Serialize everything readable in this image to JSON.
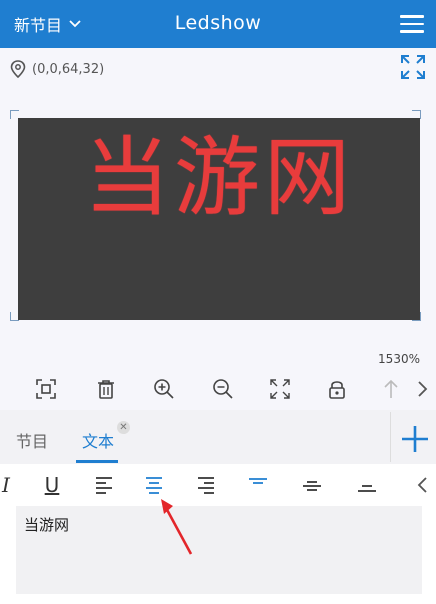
{
  "header": {
    "program_label": "新节目",
    "title": "Ledshow",
    "menu_icon": "menu-icon",
    "accent_color": "#1f7ed0"
  },
  "stage": {
    "coord_text": "(0,0,64,32)",
    "led_text": "当游网",
    "led_color": "#e83c3c",
    "zoom": "1530%"
  },
  "toolbar": {
    "icons": [
      "fit-screen-icon",
      "delete-icon",
      "zoom-in-icon",
      "zoom-out-icon",
      "full-screen-icon",
      "lock-icon",
      "arrow-up-icon",
      "chevron-right-icon"
    ]
  },
  "tabs": {
    "items": [
      {
        "label": "节目"
      },
      {
        "label": "文本"
      }
    ],
    "close_symbol": "✕"
  },
  "format_bar": {
    "italic": "I",
    "underline": "U"
  },
  "editor": {
    "text": "当游网"
  }
}
